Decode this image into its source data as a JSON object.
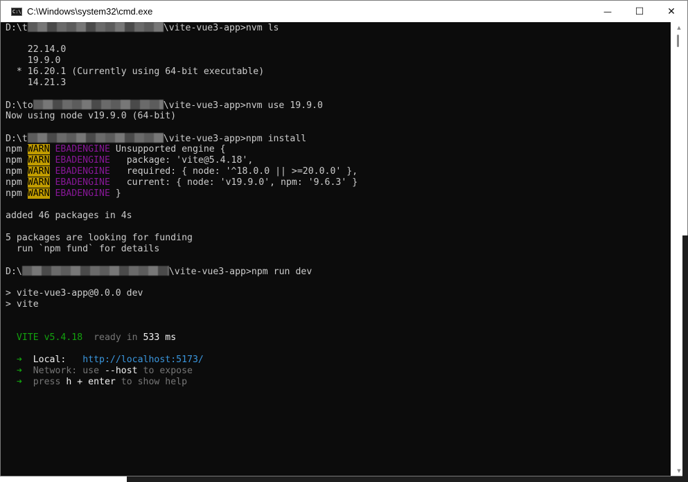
{
  "window": {
    "title": "C:\\Windows\\system32\\cmd.exe",
    "app_icon_glyph": "C:\\",
    "minimize_glyph": "—",
    "maximize_glyph": "☐",
    "close_glyph": "✕"
  },
  "console": {
    "lines": [
      [
        {
          "t": "D:\\t"
        },
        {
          "redacted": true,
          "w": 196
        },
        {
          "t": "\\vite-vue3-app>nvm ls"
        }
      ],
      [],
      [
        {
          "t": "    22.14.0"
        }
      ],
      [
        {
          "t": "    19.9.0"
        }
      ],
      [
        {
          "t": "  * 16.20.1 (Currently using 64-bit executable)"
        }
      ],
      [
        {
          "t": "    14.21.3"
        }
      ],
      [],
      [
        {
          "t": "D:\\to"
        },
        {
          "redacted": true,
          "w": 188
        },
        {
          "t": "\\vite-vue3-app>nvm use 19.9.0"
        }
      ],
      [
        {
          "t": "Now using node v19.9.0 (64-bit)"
        }
      ],
      [],
      [
        {
          "t": "D:\\t"
        },
        {
          "redacted": true,
          "w": 196
        },
        {
          "t": "\\vite-vue3-app>npm install"
        }
      ],
      [
        {
          "t": "npm "
        },
        {
          "t": "WARN",
          "c": "warn-bg"
        },
        {
          "t": " "
        },
        {
          "t": "EBADENGINE",
          "c": "magenta"
        },
        {
          "t": " Unsupported engine {"
        }
      ],
      [
        {
          "t": "npm "
        },
        {
          "t": "WARN",
          "c": "warn-bg"
        },
        {
          "t": " "
        },
        {
          "t": "EBADENGINE",
          "c": "magenta"
        },
        {
          "t": "   package: 'vite@5.4.18',"
        }
      ],
      [
        {
          "t": "npm "
        },
        {
          "t": "WARN",
          "c": "warn-bg"
        },
        {
          "t": " "
        },
        {
          "t": "EBADENGINE",
          "c": "magenta"
        },
        {
          "t": "   required: { node: '^18.0.0 || >=20.0.0' },"
        }
      ],
      [
        {
          "t": "npm "
        },
        {
          "t": "WARN",
          "c": "warn-bg"
        },
        {
          "t": " "
        },
        {
          "t": "EBADENGINE",
          "c": "magenta"
        },
        {
          "t": "   current: { node: 'v19.9.0', npm: '9.6.3' }"
        }
      ],
      [
        {
          "t": "npm "
        },
        {
          "t": "WARN",
          "c": "warn-bg"
        },
        {
          "t": " "
        },
        {
          "t": "EBADENGINE",
          "c": "magenta"
        },
        {
          "t": " }"
        }
      ],
      [],
      [
        {
          "t": "added 46 packages in 4s"
        }
      ],
      [],
      [
        {
          "t": "5 packages are looking for funding"
        }
      ],
      [
        {
          "t": "  run `npm fund` for details"
        }
      ],
      [],
      [
        {
          "t": "D:\\"
        },
        {
          "redacted": true,
          "w": 212
        },
        {
          "t": "\\vite-vue3-app>npm run dev"
        }
      ],
      [],
      [
        {
          "t": "> vite-vue3-app@0.0.0 dev"
        }
      ],
      [
        {
          "t": "> vite"
        }
      ],
      [],
      [],
      [
        {
          "t": "  "
        },
        {
          "t": "VITE v5.4.18",
          "c": "green"
        },
        {
          "t": "  "
        },
        {
          "t": "ready in ",
          "c": "gray"
        },
        {
          "t": "533",
          "c": "white"
        },
        {
          "t": " ms",
          "c": "white"
        }
      ],
      [],
      [
        {
          "t": "  "
        },
        {
          "t": "➜",
          "c": "green"
        },
        {
          "t": "  "
        },
        {
          "t": "Local:",
          "c": "white"
        },
        {
          "t": "   "
        },
        {
          "t": "http://localhost:5173/",
          "c": "cyan"
        }
      ],
      [
        {
          "t": "  "
        },
        {
          "t": "➜",
          "c": "green"
        },
        {
          "t": "  "
        },
        {
          "t": "Network: use ",
          "c": "gray"
        },
        {
          "t": "--host",
          "c": "white"
        },
        {
          "t": " to expose",
          "c": "gray"
        }
      ],
      [
        {
          "t": "  "
        },
        {
          "t": "➜",
          "c": "green"
        },
        {
          "t": "  "
        },
        {
          "t": "press ",
          "c": "gray"
        },
        {
          "t": "h + enter",
          "c": "white"
        },
        {
          "t": " to show help",
          "c": "gray"
        }
      ]
    ]
  },
  "scrollbar": {
    "up_glyph": "▲",
    "down_glyph": "▼"
  },
  "colors": {
    "background": "#0c0c0c",
    "foreground": "#cccccc",
    "warn": "#c19c00",
    "magenta": "#881798",
    "green": "#13a10e",
    "cyan": "#3a96dd"
  }
}
